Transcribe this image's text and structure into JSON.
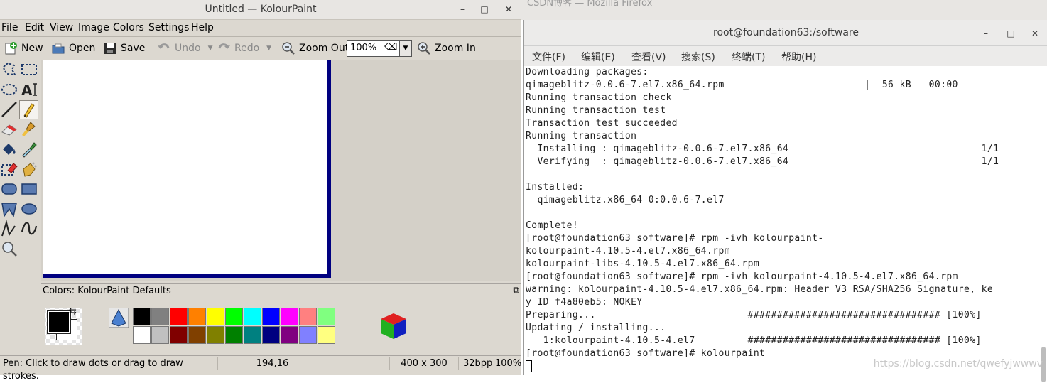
{
  "kolourpaint": {
    "title": "Untitled — KolourPaint",
    "window_controls": [
      "–",
      "□",
      "✕"
    ],
    "menu": [
      "File",
      "Edit",
      "View",
      "Image",
      "Colors",
      "Settings",
      "Help"
    ],
    "toolbar": {
      "new": "New",
      "open": "Open",
      "save": "Save",
      "undo": "Undo",
      "redo": "Redo",
      "zoom_out": "Zoom Out",
      "zoom_value": "100%",
      "zoom_in": "Zoom In"
    },
    "tools": [
      "free-form-selection",
      "rectangular-selection",
      "elliptical-selection",
      "text",
      "line",
      "pen",
      "eraser",
      "brush",
      "flood-fill",
      "color-picker",
      "color-eraser",
      "spraycan",
      "rounded-rectangle",
      "rectangle",
      "polygon",
      "ellipse",
      "connected-lines",
      "curve",
      "zoom"
    ],
    "colors_panel_title": "Colors: KolourPaint Defaults",
    "palette_top": [
      "#000000",
      "#808080",
      "#ff0000",
      "#ff8000",
      "#ffff00",
      "#00ff00",
      "#00ffff",
      "#0000ff",
      "#ff00ff",
      "#ff8080",
      "#80ff80"
    ],
    "palette_bottom": [
      "#ffffff",
      "#c0c0c0",
      "#800000",
      "#804000",
      "#808000",
      "#008000",
      "#008080",
      "#000080",
      "#800080",
      "#8080ff",
      "#ffff80"
    ],
    "foreground_color": "#000000",
    "status": {
      "message": "Pen: Click to draw dots or drag to draw strokes.",
      "coords": "194,16",
      "size": "400 x 300",
      "depth": "32bpp",
      "zoom": "100%"
    }
  },
  "background_window": {
    "title_fragment": "CSDN博客 — Mozilla Firefox"
  },
  "terminal": {
    "title": "root@foundation63:/software",
    "window_controls": [
      "–",
      "□",
      "✕"
    ],
    "menu": [
      "文件(F)",
      "编辑(E)",
      "查看(V)",
      "搜索(S)",
      "终端(T)",
      "帮助(H)"
    ],
    "lines": [
      "Downloading packages:",
      "qimageblitz-0.0.6-7.el7.x86_64.rpm                        |  56 kB   00:00",
      "Running transaction check",
      "Running transaction test",
      "Transaction test succeeded",
      "Running transaction",
      "  Installing : qimageblitz-0.0.6-7.el7.x86_64                                 1/1",
      "  Verifying  : qimageblitz-0.0.6-7.el7.x86_64                                 1/1",
      "",
      "Installed:",
      "  qimageblitz.x86_64 0:0.0.6-7.el7",
      "",
      "Complete!",
      "[root@foundation63 software]# rpm -ivh kolourpaint-",
      "kolourpaint-4.10.5-4.el7.x86_64.rpm",
      "kolourpaint-libs-4.10.5-4.el7.x86_64.rpm",
      "[root@foundation63 software]# rpm -ivh kolourpaint-4.10.5-4.el7.x86_64.rpm",
      "warning: kolourpaint-4.10.5-4.el7.x86_64.rpm: Header V3 RSA/SHA256 Signature, ke",
      "y ID f4a80eb5: NOKEY",
      "Preparing...                          ################################# [100%]",
      "Updating / installing...",
      "   1:kolourpaint-4.10.5-4.el7         ################################# [100%]",
      "[root@foundation63 software]# kolourpaint"
    ]
  },
  "watermark": "https://blog.csdn.net/qwefyjwwwv"
}
